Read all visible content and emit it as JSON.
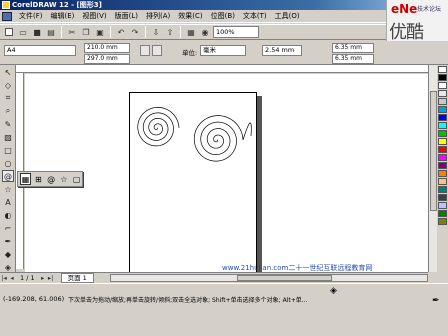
{
  "window": {
    "title": "CorelDRAW 12 - [图形3]"
  },
  "menu": [
    "文件(F)",
    "编辑(E)",
    "视图(V)",
    "版面(L)",
    "排列(A)",
    "效果(C)",
    "位图(B)",
    "文本(T)",
    "工具(O)"
  ],
  "logo": {
    "brand": "eNe",
    "brand_sub": "技术论坛",
    "big": "优酷"
  },
  "toolbar": {
    "zoom": "100%"
  },
  "propbar": {
    "paper_size": "A4",
    "width": "210.0 mm",
    "height": "297.0 mm",
    "unit_label": "单位:",
    "unit": "毫米",
    "nudge": "2.54 mm",
    "dup_x": "6.35 mm",
    "dup_y": "6.35 mm"
  },
  "pagebar": {
    "page_count": "1 / 1",
    "page_tab": "页面 1"
  },
  "watermark": "www.21hulian.com二十一世纪互联远程教育网",
  "status": {
    "coords": "(-169.208, 61.006)",
    "hint": "下次单击为拖动/缩放;再单击旋转/倾斜;双击全选对象; Shift+单击选择多个对象; Alt+单..."
  },
  "palette": [
    "#ffffff",
    "#000000",
    "#ffffff",
    "#e6e6e6",
    "#c8c8c8",
    "#00a0e0",
    "#0000ff",
    "#00ffff",
    "#00c000",
    "#ffff00",
    "#ff0000",
    "#ff00ff",
    "#800080",
    "#ff8000",
    "#ffc080",
    "#008080",
    "#404040",
    "#c0c0ff",
    "#008000",
    "#808000"
  ]
}
